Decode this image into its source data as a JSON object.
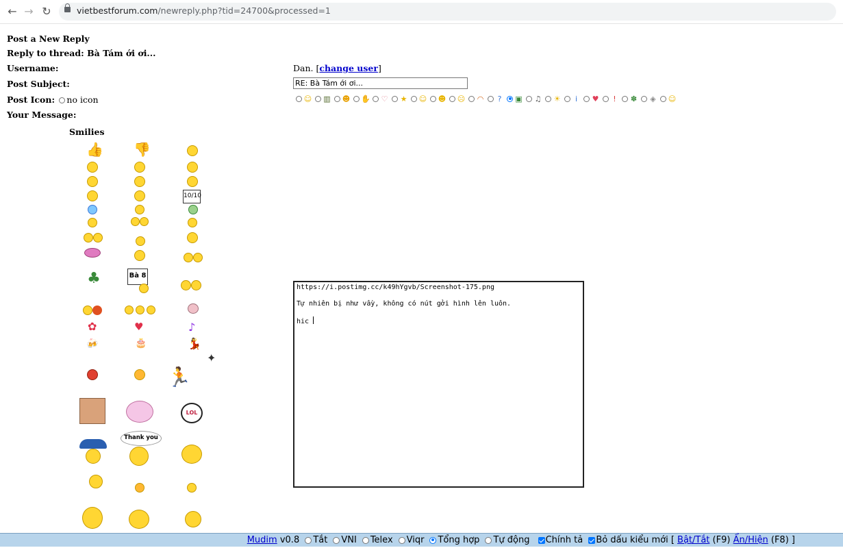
{
  "browser": {
    "url_host": "vietbestforum.com",
    "url_path": "/newreply.php?tid=24700&processed=1"
  },
  "form": {
    "title": "Post a New Reply",
    "reply_to": "Reply to thread: Bà Tám ới ơi...",
    "username_label": "Username:",
    "username_value": "Dan.",
    "change_user": "change user",
    "subject_label": "Post Subject:",
    "subject_value": "RE: Bà Tám ới ơi...",
    "icon_label": "Post Icon:",
    "no_icon": "no icon",
    "message_label": "Your Message:",
    "post_icons": [
      {
        "icon": "smile-icon",
        "glyph": "☺",
        "color": "#e8b400",
        "selected": false
      },
      {
        "icon": "film-icon",
        "glyph": "▥",
        "color": "#556b2f",
        "selected": false
      },
      {
        "icon": "wink-icon",
        "glyph": "☻",
        "color": "#e8a000",
        "selected": false
      },
      {
        "icon": "hand-icon",
        "glyph": "✋",
        "color": "#e07b8a",
        "selected": false
      },
      {
        "icon": "heart-outline-icon",
        "glyph": "♡",
        "color": "#e07b8a",
        "selected": false
      },
      {
        "icon": "star-icon",
        "glyph": "★",
        "color": "#e8b400",
        "selected": false
      },
      {
        "icon": "grin-icon",
        "glyph": "☺",
        "color": "#e8b400",
        "selected": false
      },
      {
        "icon": "cool-icon",
        "glyph": "☻",
        "color": "#e8b400",
        "selected": false
      },
      {
        "icon": "sad-icon",
        "glyph": "☹",
        "color": "#e8b400",
        "selected": false
      },
      {
        "icon": "rainbow-icon",
        "glyph": "◠",
        "color": "#d2691e",
        "selected": false
      },
      {
        "icon": "question-icon",
        "glyph": "?",
        "color": "#3a78d8",
        "selected": false
      },
      {
        "icon": "picture-icon",
        "glyph": "▣",
        "color": "#3a8a3a",
        "selected": true
      },
      {
        "icon": "music-icon",
        "glyph": "♫",
        "color": "#555555",
        "selected": false
      },
      {
        "icon": "bulb-icon",
        "glyph": "☀",
        "color": "#e8b400",
        "selected": false
      },
      {
        "icon": "info-icon",
        "glyph": "i",
        "color": "#3a78d8",
        "selected": false
      },
      {
        "icon": "heart-icon",
        "glyph": "♥",
        "color": "#e0405a",
        "selected": false
      },
      {
        "icon": "exclamation-icon",
        "glyph": "!",
        "color": "#d83a3a",
        "selected": false
      },
      {
        "icon": "plant-icon",
        "glyph": "✽",
        "color": "#3a8a3a",
        "selected": false
      },
      {
        "icon": "box-icon",
        "glyph": "◈",
        "color": "#888888",
        "selected": false
      },
      {
        "icon": "laugh-icon",
        "glyph": "☺",
        "color": "#e8b400",
        "selected": false
      }
    ]
  },
  "smilies": {
    "heading": "Smilies",
    "sign_text": "Bà 8",
    "thank_you": "Thank you",
    "lol": "LOL",
    "tenten": "10/10"
  },
  "message": {
    "lines": [
      "https://i.postimg.cc/k49hYgvb/Screenshot-175.png",
      "",
      "Tự nhiên bị như vầy, không có nút gởi hình lên luôn.",
      "",
      "hic "
    ]
  },
  "mudim": {
    "name": "Mudim",
    "version": "v0.8",
    "options": [
      "Tắt",
      "VNI",
      "Telex",
      "Viqr",
      "Tổng hợp",
      "Tự động"
    ],
    "selected": "Tổng hợp",
    "spell": "Chính tả",
    "newstyle": "Bỏ dấu kiểu mới",
    "toggle": "Bật/Tắt",
    "toggle_key": "(F9)",
    "showhide": "Ẩn/Hiện",
    "showhide_key": "(F8)"
  }
}
